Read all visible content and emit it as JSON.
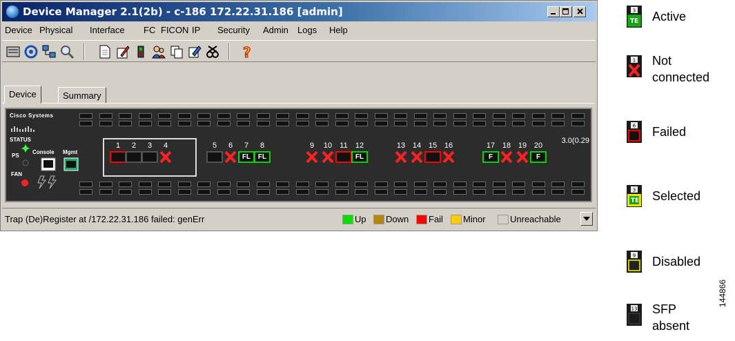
{
  "window": {
    "title": "Device Manager 2.1(2b) - c-186 172.22.31.186 [admin]",
    "minimize_label": "_",
    "restore_label": "□",
    "close_label": "×"
  },
  "menu": [
    "Device",
    "Physical",
    "Interface",
    "FC",
    "FICON",
    "IP",
    "Security",
    "Admin",
    "Logs",
    "Help"
  ],
  "toolbar_icons": [
    "chassis-icon",
    "refresh-icon",
    "topology-icon",
    "zoom-icon",
    "log-icon",
    "config-icon",
    "bar-icon",
    "users-icon",
    "copy-icon",
    "edit-icon",
    "tools-icon",
    "help-icon"
  ],
  "tabs": [
    "Device",
    "Summary"
  ],
  "chassis": {
    "brand": "Cisco Systems",
    "status_label": "STATUS",
    "ps_label": "PS",
    "fan_label": "FAN",
    "console_label": "Console",
    "mgmt_label": "Mgmt",
    "version": "3.0(0.29",
    "ports": [
      {
        "num": "1",
        "state": "fail",
        "label": ""
      },
      {
        "num": "2",
        "state": "blank",
        "label": ""
      },
      {
        "num": "3",
        "state": "blank",
        "label": ""
      },
      {
        "num": "4",
        "state": "x",
        "label": ""
      },
      {
        "num": "5",
        "state": "blank",
        "label": ""
      },
      {
        "num": "6",
        "state": "x",
        "label": ""
      },
      {
        "num": "7",
        "state": "up",
        "label": "FL"
      },
      {
        "num": "8",
        "state": "up",
        "label": "FL"
      },
      {
        "num": "9",
        "state": "x",
        "label": ""
      },
      {
        "num": "10",
        "state": "x",
        "label": ""
      },
      {
        "num": "11",
        "state": "fail",
        "label": ""
      },
      {
        "num": "12",
        "state": "up",
        "label": "FL"
      },
      {
        "num": "13",
        "state": "x",
        "label": ""
      },
      {
        "num": "14",
        "state": "x",
        "label": ""
      },
      {
        "num": "15",
        "state": "fail",
        "label": ""
      },
      {
        "num": "16",
        "state": "x",
        "label": ""
      },
      {
        "num": "17",
        "state": "up",
        "label": "F"
      },
      {
        "num": "18",
        "state": "x",
        "label": ""
      },
      {
        "num": "19",
        "state": "x",
        "label": ""
      },
      {
        "num": "20",
        "state": "up",
        "label": "F"
      }
    ]
  },
  "statusbar": {
    "message": "Trap (De)Register at /172.22.31.186 failed: genErr",
    "legend": [
      {
        "label": "Up",
        "color": "#00e000"
      },
      {
        "label": "Down",
        "color": "#b8860b"
      },
      {
        "label": "Fail",
        "color": "#ff0000"
      },
      {
        "label": "Minor",
        "color": "#ffcc00"
      },
      {
        "label": "Unreachable",
        "color": "#d4d0c8"
      }
    ]
  },
  "legend": [
    {
      "num": "3",
      "tag": "TE",
      "text": "Active"
    },
    {
      "num": "1",
      "tag": "",
      "text": "Not\nconnected"
    },
    {
      "num": "6",
      "tag": "",
      "text": "Failed"
    },
    {
      "num": "3",
      "tag": "TE",
      "text": "Selected"
    },
    {
      "num": "9",
      "tag": "",
      "text": "Disabled"
    },
    {
      "num": "13",
      "tag": "",
      "text": "SFP\nabsent"
    }
  ],
  "figure_id": "144866"
}
